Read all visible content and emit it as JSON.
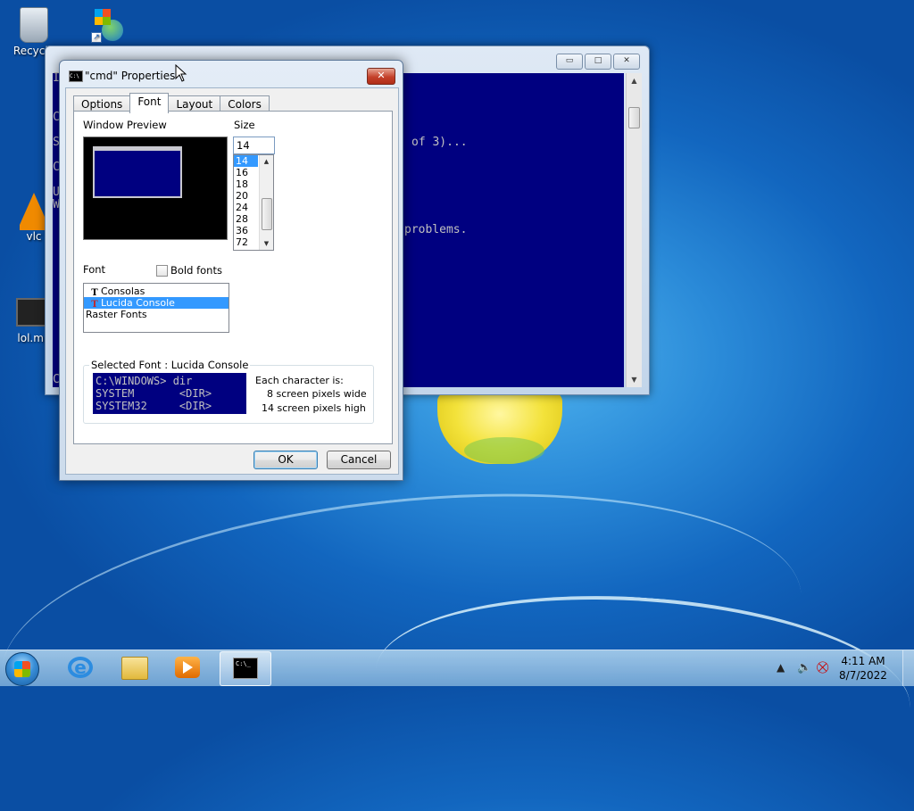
{
  "desktop": {
    "icons": [
      {
        "label": "Recycle"
      },
      {
        "label": "vlc"
      },
      {
        "label": "lol.mp"
      }
    ]
  },
  "cmd_window": {
    "text_lines": [
      {
        "text": "of 3)..."
      },
      {
        "text": "problems."
      }
    ],
    "left_letters": [
      "I",
      "C",
      "S",
      "C",
      "U",
      "W",
      "C"
    ],
    "buttons": {
      "minimize": "▭",
      "maximize": "□",
      "close": "✕"
    }
  },
  "dialog": {
    "title": "\"cmd\" Properties",
    "close_label": "✕",
    "tabs": [
      "Options",
      "Font",
      "Layout",
      "Colors"
    ],
    "active_tab": "Font",
    "window_preview_label": "Window Preview",
    "size_label": "Size",
    "size_value": "14",
    "size_options": [
      "14",
      "16",
      "18",
      "20",
      "24",
      "28",
      "36",
      "72"
    ],
    "selected_size": "14",
    "font_label": "Font",
    "bold_fonts_label": "Bold fonts",
    "fonts": [
      {
        "name": "Consolas",
        "icon": "truetype-icon"
      },
      {
        "name": "Lucida Console",
        "icon": "truetype-icon"
      },
      {
        "name": "Raster Fonts",
        "icon": ""
      }
    ],
    "selected_font": "Lucida Console",
    "selected_font_group_title": "Selected Font : Lucida Console",
    "sample_lines": [
      "C:\\WINDOWS> dir",
      "SYSTEM       <DIR>",
      "SYSTEM32     <DIR>"
    ],
    "each_char_label": "Each character is:",
    "char_width_label": "8 screen pixels wide",
    "char_height_label": "14 screen pixels high",
    "ok_label": "OK",
    "cancel_label": "Cancel"
  },
  "taskbar": {
    "time": "4:11 AM",
    "date": "8/7/2022",
    "cmd_glyph_text": "C:\\_"
  },
  "colors": {
    "console_bg": "#000080",
    "selection": "#3399ff"
  }
}
